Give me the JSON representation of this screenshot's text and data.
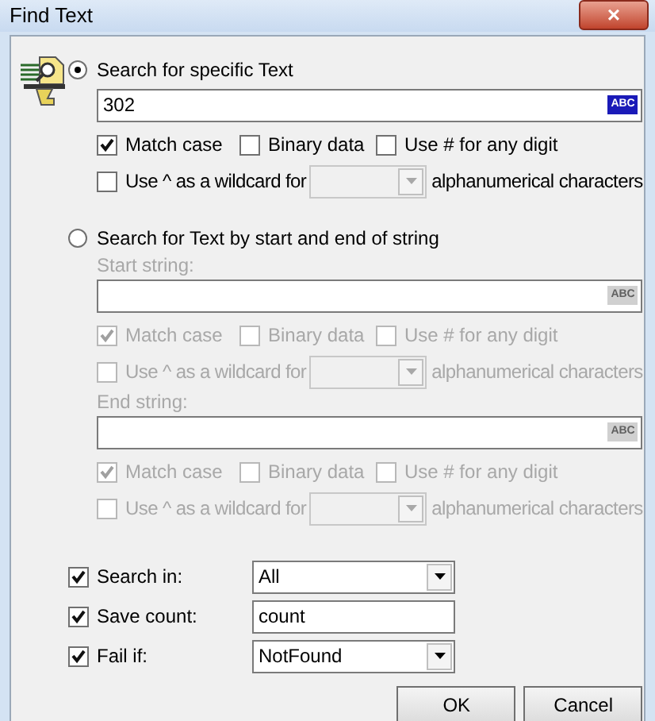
{
  "window": {
    "title": "Find Text",
    "close": "×"
  },
  "specific": {
    "label": "Search for specific Text",
    "selected": true,
    "disabled": false,
    "fields": [
      {
        "value": "302",
        "button": "ABC",
        "options": [
          {
            "label": "Match case",
            "checked": true
          },
          {
            "label": "Binary data",
            "checked": false
          },
          {
            "label": "Use # for any digit",
            "checked": false
          }
        ],
        "wildcard": {
          "before": "Use ^ as a wildcard for",
          "after": "alphanumerical characters",
          "checked": false
        }
      }
    ]
  },
  "start_end": {
    "label": "Search for Text by start and end of string",
    "selected": false,
    "disabled": true,
    "fields": [
      {
        "label": "Start string:",
        "button": "ABC",
        "options": [
          {
            "label": "Match case",
            "checked": true
          },
          {
            "label": "Binary data",
            "checked": false
          },
          {
            "label": "Use # for any digit",
            "checked": false
          }
        ],
        "wildcard": {
          "before": "Use ^ as a wildcard for",
          "after": "alphanumerical characters",
          "checked": false
        }
      },
      {
        "label": "End string:",
        "button": "ABC",
        "options": [
          {
            "label": "Match case",
            "checked": true
          },
          {
            "label": "Binary data",
            "checked": false
          },
          {
            "label": "Use # for any digit",
            "checked": false
          }
        ],
        "wildcard": {
          "before": "Use ^ as a wildcard for",
          "after": "alphanumerical characters",
          "checked": false
        }
      }
    ]
  },
  "settings": [
    {
      "label": "Search in:",
      "checked": true,
      "kind": "dropdown",
      "value": "All"
    },
    {
      "label": "Save count:",
      "checked": true,
      "kind": "text",
      "value": "count"
    },
    {
      "label": "Fail if:",
      "checked": true,
      "kind": "dropdown",
      "value": "NotFound"
    }
  ],
  "buttons": [
    "OK",
    "Cancel"
  ]
}
